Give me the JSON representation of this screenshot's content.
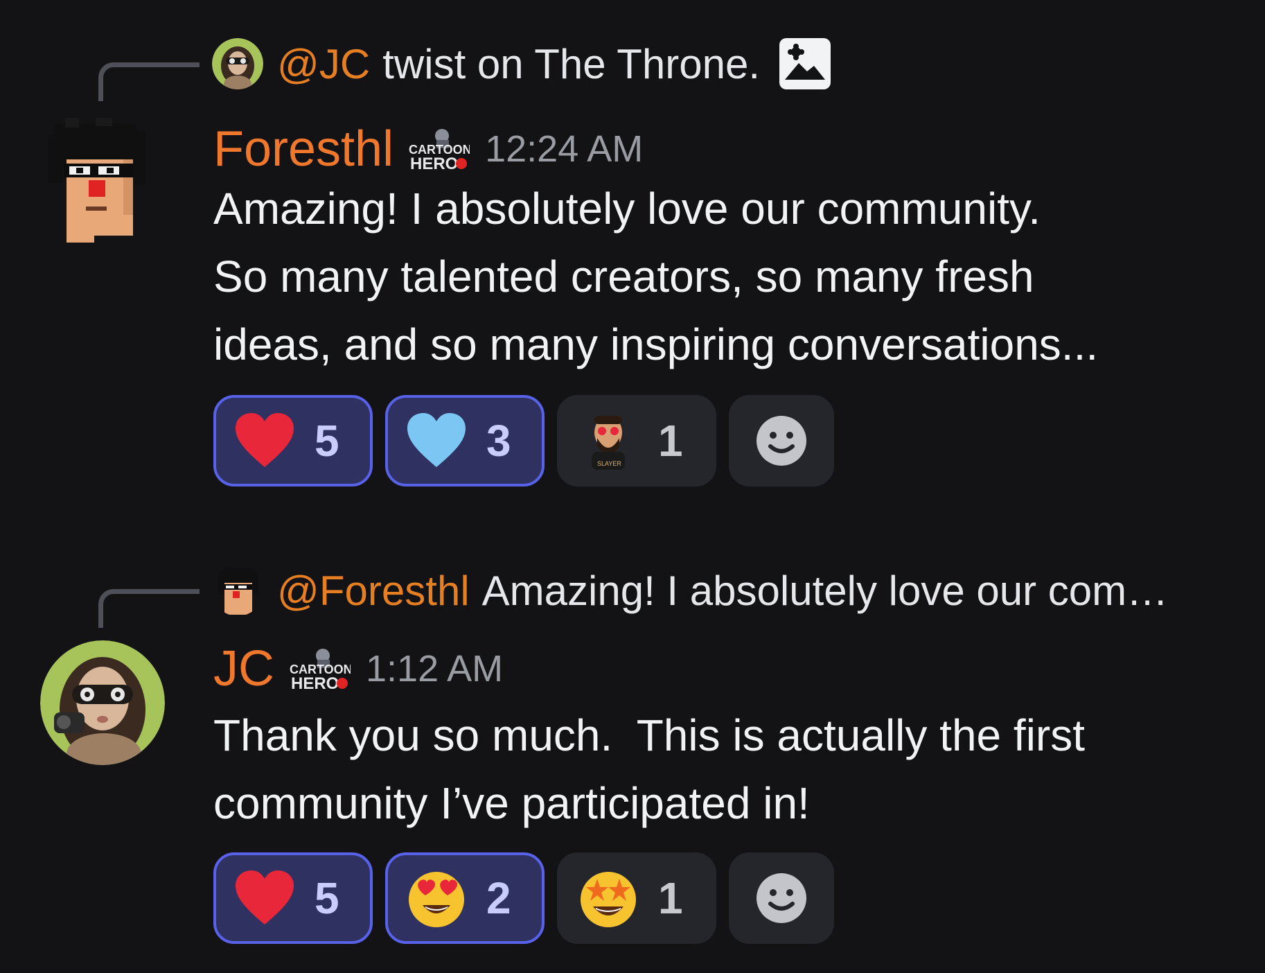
{
  "messages": [
    {
      "reply": {
        "mention": "@JC",
        "text": "twist on The Throne.",
        "attachment_icon": "image-icon"
      },
      "author": "Foresthl",
      "badge": "CARTOON HERO",
      "badge_line1": "CARTOON",
      "badge_line2": "HERO",
      "timestamp": "12:24 AM",
      "body_lines": [
        "Amazing! I absolutely love our community.",
        "So many talented creators, so many fresh",
        "ideas, and so many inspiring conversations..."
      ],
      "reactions": [
        {
          "emoji": "red-heart",
          "count": "5",
          "active": true
        },
        {
          "emoji": "blue-heart",
          "count": "3",
          "active": true
        },
        {
          "emoji": "custom-avatar-slayer",
          "label": "SLAYER",
          "count": "1",
          "active": false
        }
      ],
      "add_reaction_icon": "smiley-add-icon",
      "colors": {
        "author": "#f0782c"
      }
    },
    {
      "reply": {
        "mention": "@Foresthl",
        "text": "Amazing! I absolutely love our com…"
      },
      "author": "JC",
      "badge": "CARTOON HERO",
      "badge_line1": "CARTOON",
      "badge_line2": "HERO",
      "timestamp": "1:12 AM",
      "body_lines": [
        "Thank you so much.  This is actually the first",
        "community I’ve participated in!"
      ],
      "reactions": [
        {
          "emoji": "red-heart",
          "count": "5",
          "active": true
        },
        {
          "emoji": "heart-eyes",
          "count": "2",
          "active": true
        },
        {
          "emoji": "star-struck",
          "count": "1",
          "active": false
        }
      ],
      "add_reaction_icon": "smiley-add-icon",
      "colors": {
        "author": "#f0782c"
      }
    }
  ],
  "colors": {
    "background": "#131316",
    "mention": "#e67e22",
    "active_reaction_bg": "#2f3160",
    "active_reaction_border": "#5862e8",
    "inactive_reaction_bg": "#25262b",
    "timestamp": "#9a9ca3"
  }
}
